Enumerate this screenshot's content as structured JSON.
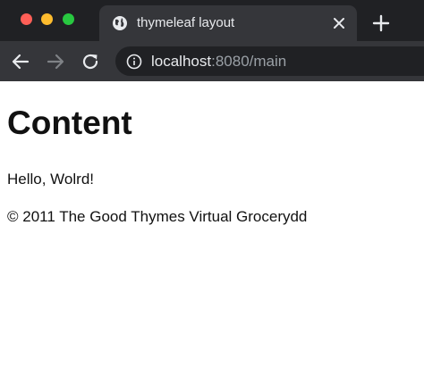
{
  "browser": {
    "window_controls": [
      "close",
      "minimize",
      "zoom"
    ],
    "tab": {
      "icon": "globe-icon",
      "title": "thymeleaf layout",
      "close_icon": "close-icon"
    },
    "new_tab_icon": "plus-icon",
    "toolbar": {
      "back_icon": "arrow-left-icon",
      "forward_icon": "arrow-right-icon",
      "forward_enabled": false,
      "reload_icon": "reload-icon"
    },
    "address_bar": {
      "icon": "info-icon",
      "host": "localhost",
      "path": ":8080/main"
    }
  },
  "page": {
    "heading": "Content",
    "greeting": "Hello, Wolrd!",
    "footer": "© 2011 The Good Thymes Virtual Grocerydd"
  },
  "colors": {
    "titlebar": "#202124",
    "toolbar": "#35363a",
    "traffic_red": "#ff5f57",
    "traffic_yellow": "#febc2e",
    "traffic_green": "#28c840",
    "text": "#111111"
  }
}
